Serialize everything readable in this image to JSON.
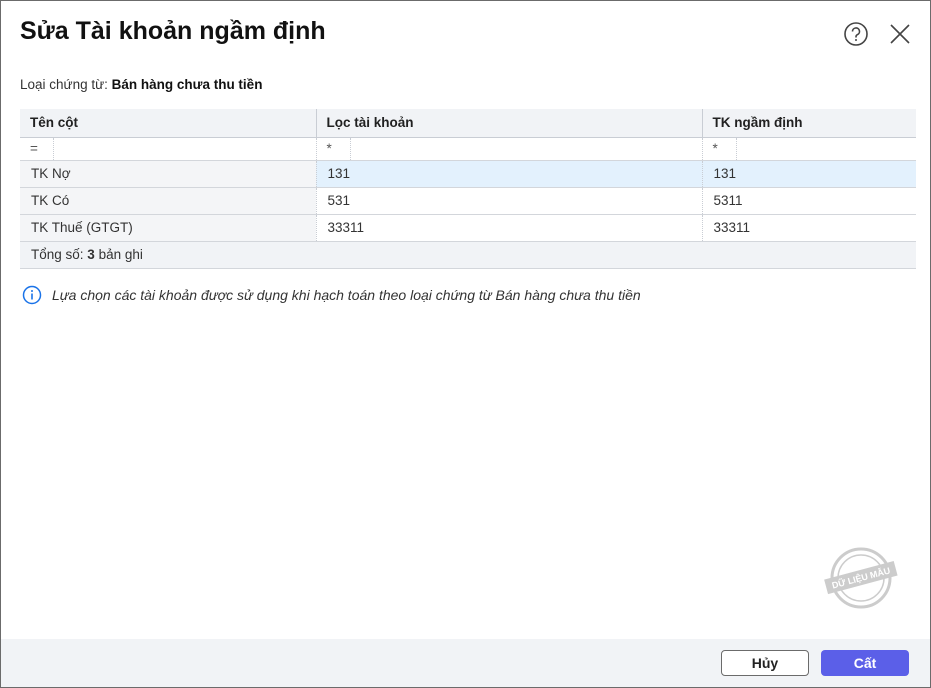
{
  "dialog": {
    "title": "Sửa Tài khoản ngầm định"
  },
  "voucher": {
    "label": "Loại chứng từ:",
    "value": "Bán hàng chưa thu tiền"
  },
  "table": {
    "headers": [
      "Tên cột",
      "Lọc tài khoản",
      "TK ngầm định"
    ],
    "filters": [
      "=",
      "*",
      "*"
    ],
    "rows": [
      {
        "name": "TK Nợ",
        "filter": "131",
        "default": "131"
      },
      {
        "name": "TK Có",
        "filter": "531",
        "default": "5311"
      },
      {
        "name": "TK Thuế (GTGT)",
        "filter": "33311",
        "default": "33311"
      }
    ],
    "footer": {
      "label": "Tổng số:",
      "count": "3",
      "suffix": "bản ghi"
    }
  },
  "info": "Lựa chọn các tài khoản được sử dụng khi hạch toán theo loại chứng từ Bán hàng chưa thu tiền",
  "watermark": "DỮ LIỆU MẪU",
  "buttons": {
    "cancel": "Hủy",
    "save": "Cất"
  },
  "colors": {
    "primary": "#5b5fe8",
    "selected": "#e3f1fd",
    "info": "#1a73e8"
  }
}
